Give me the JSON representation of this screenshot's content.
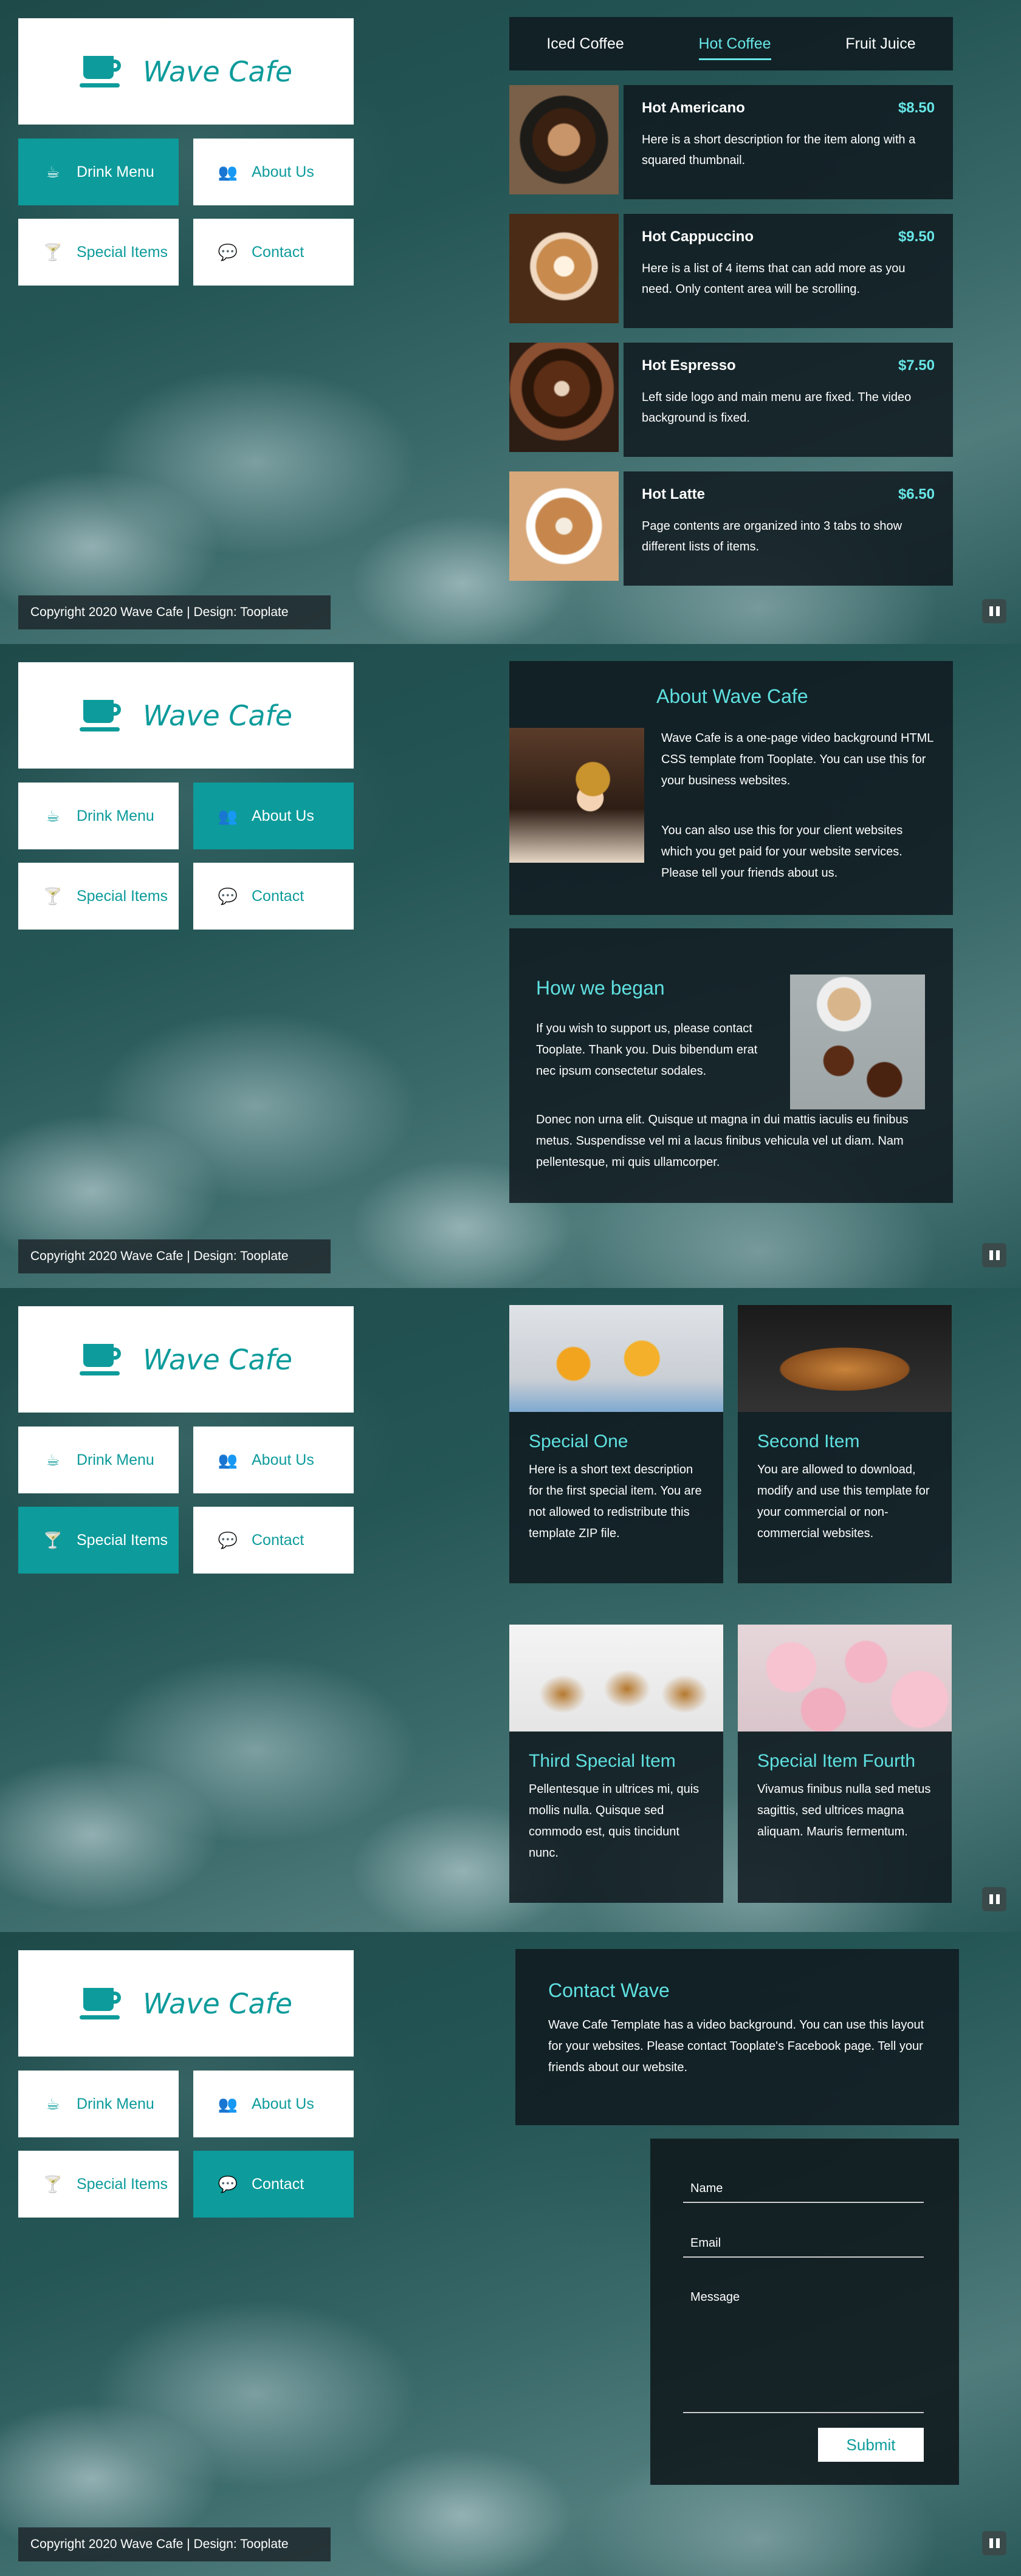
{
  "brand": {
    "name": "Wave Cafe"
  },
  "nav": {
    "drink": "Drink Menu",
    "about": "About Us",
    "special": "Special Items",
    "contact": "Contact"
  },
  "footer": "Copyright 2020 Wave Cafe | Design: Tooplate",
  "menu": {
    "tabs": [
      "Iced Coffee",
      "Hot Coffee",
      "Fruit Juice"
    ],
    "active_tab": "Hot Coffee",
    "items": [
      {
        "name": "Hot Americano",
        "price": "$8.50",
        "desc": "Here is a short description for the item along with a squared thumbnail."
      },
      {
        "name": "Hot Cappuccino",
        "price": "$9.50",
        "desc": "Here is a list of 4 items that can add more as you need. Only content area will be scrolling."
      },
      {
        "name": "Hot Espresso",
        "price": "$7.50",
        "desc": "Left side logo and main menu are fixed. The video background is fixed."
      },
      {
        "name": "Hot Latte",
        "price": "$6.50",
        "desc": "Page contents are organized into 3 tabs to show different lists of items."
      }
    ]
  },
  "about": {
    "title": "About Wave Cafe",
    "p1": "Wave Cafe is a one-page video background HTML CSS template from Tooplate. You can use this for your business websites.",
    "p2": "You can also use this for your client websites which you get paid for your website services. Please tell your friends about us.",
    "began_title": "How we began",
    "began_p1": "If you wish to support us, please contact Tooplate. Thank you. Duis bibendum erat nec ipsum consectetur sodales.",
    "began_p2": "Donec non urna elit. Quisque ut magna in dui mattis iaculis eu finibus metus. Suspendisse vel mi a lacus finibus vehicula vel ut diam. Nam pellentesque, mi quis ullamcorper."
  },
  "special": [
    {
      "title": "Special One",
      "desc": "Here is a short text description for the first special item. You are not allowed to redistribute this template ZIP file."
    },
    {
      "title": "Second Item",
      "desc": "You are allowed to download, modify and use this template for your commercial or non-commercial websites."
    },
    {
      "title": "Third Special Item",
      "desc": "Pellentesque in ultrices mi, quis mollis nulla. Quisque sed commodo est, quis tincidunt nunc."
    },
    {
      "title": "Special Item Fourth",
      "desc": "Vivamus finibus nulla sed metus sagittis, sed ultrices magna aliquam. Mauris fermentum."
    }
  ],
  "contact": {
    "title": "Contact Wave",
    "desc": "Wave Cafe Template has a video background. You can use this layout for your websites. Please contact Tooplate's Facebook page. Tell your friends about our website.",
    "name_placeholder": "Name",
    "email_placeholder": "Email",
    "message_placeholder": "Message",
    "submit": "Submit"
  },
  "icons": {
    "logo": "coffee-cup-icon",
    "drink": "mug-icon",
    "about": "users-icon",
    "special": "cocktail-glass-icon",
    "contact": "chat-bubbles-icon",
    "pause": "pause-icon"
  },
  "colors": {
    "accent": "#0d9b9b",
    "highlight": "#5fe0e0"
  }
}
